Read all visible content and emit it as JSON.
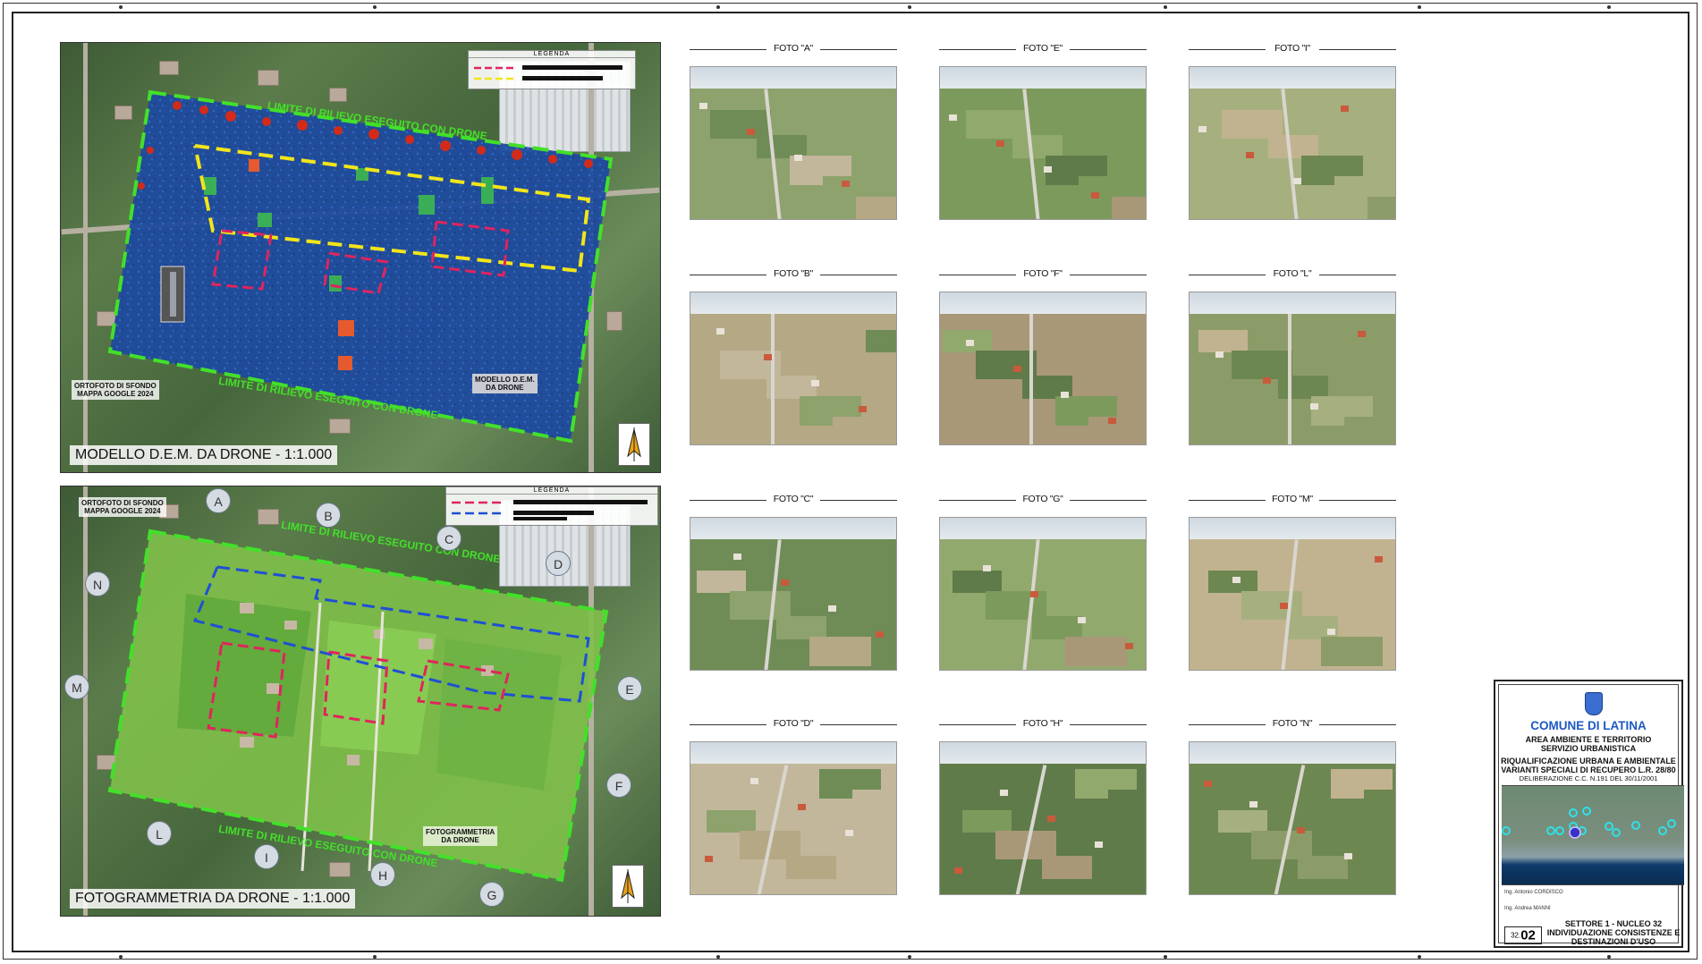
{
  "map_top": {
    "title": "MODELLO D.E.M. DA DRONE - 1:1.000",
    "legend_title": "LEGENDA",
    "label_background": "ORTOFOTO DI SFONDO\nMAPPA GOOGLE 2024",
    "label_model": "MODELLO D.E.M.\nDA DRONE",
    "boundary_label": "LIMITE DI RILIEVO ESEGUITO CON DRONE",
    "boundary_color": "#43e02a",
    "legend_colors": [
      "#e0245e",
      "#f2e51a"
    ]
  },
  "map_bottom": {
    "title": "FOTOGRAMMETRIA DA DRONE - 1:1.000",
    "legend_title": "LEGENDA",
    "label_background": "ORTOFOTO DI SFONDO\nMAPPA GOOGLE 2024",
    "label_model": "FOTOGRAMMETRIA\nDA DRONE",
    "boundary_label": "LIMITE DI RILIEVO ESEGUITO CON DRONE",
    "legend_colors": [
      "#e0245e",
      "#1f4fd6"
    ],
    "markers": [
      "A",
      "B",
      "C",
      "D",
      "E",
      "F",
      "G",
      "H",
      "I",
      "L",
      "M",
      "N"
    ]
  },
  "photos": [
    {
      "caption": "FOTO \"A\""
    },
    {
      "caption": "FOTO \"B\""
    },
    {
      "caption": "FOTO \"C\""
    },
    {
      "caption": "FOTO \"D\""
    },
    {
      "caption": "FOTO \"E\""
    },
    {
      "caption": "FOTO \"F\""
    },
    {
      "caption": "FOTO \"G\""
    },
    {
      "caption": "FOTO \"H\""
    },
    {
      "caption": "FOTO \"I\""
    },
    {
      "caption": "FOTO \"L\""
    },
    {
      "caption": "FOTO \"M\""
    },
    {
      "caption": "FOTO \"N\""
    }
  ],
  "title_block": {
    "municipality": "COMUNE DI LATINA",
    "dept1": "AREA AMBIENTE E TERRITORIO",
    "dept2": "SERVIZIO URBANISTICA",
    "project1": "RIQUALIFICAZIONE URBANA E AMBIENTALE",
    "project2": "VARIANTI SPECIALI DI RECUPERO L.R. 28/80",
    "deliberation": "DELIBERAZIONE C.C. N.191 DEL 30/11/2001",
    "signature1": "Ing. Antonio CORDISCO",
    "signature2": "Ing. Andrea MANNI",
    "sheet_prefix": "32.",
    "sheet_number": "02",
    "desc1": "SETTORE 1 - NUCLEO 32",
    "desc2": "INDIVIDUAZIONE CONSISTENZE E",
    "desc3": "DESTINAZIONI D'USO",
    "brand_color": "#1d58c6"
  }
}
